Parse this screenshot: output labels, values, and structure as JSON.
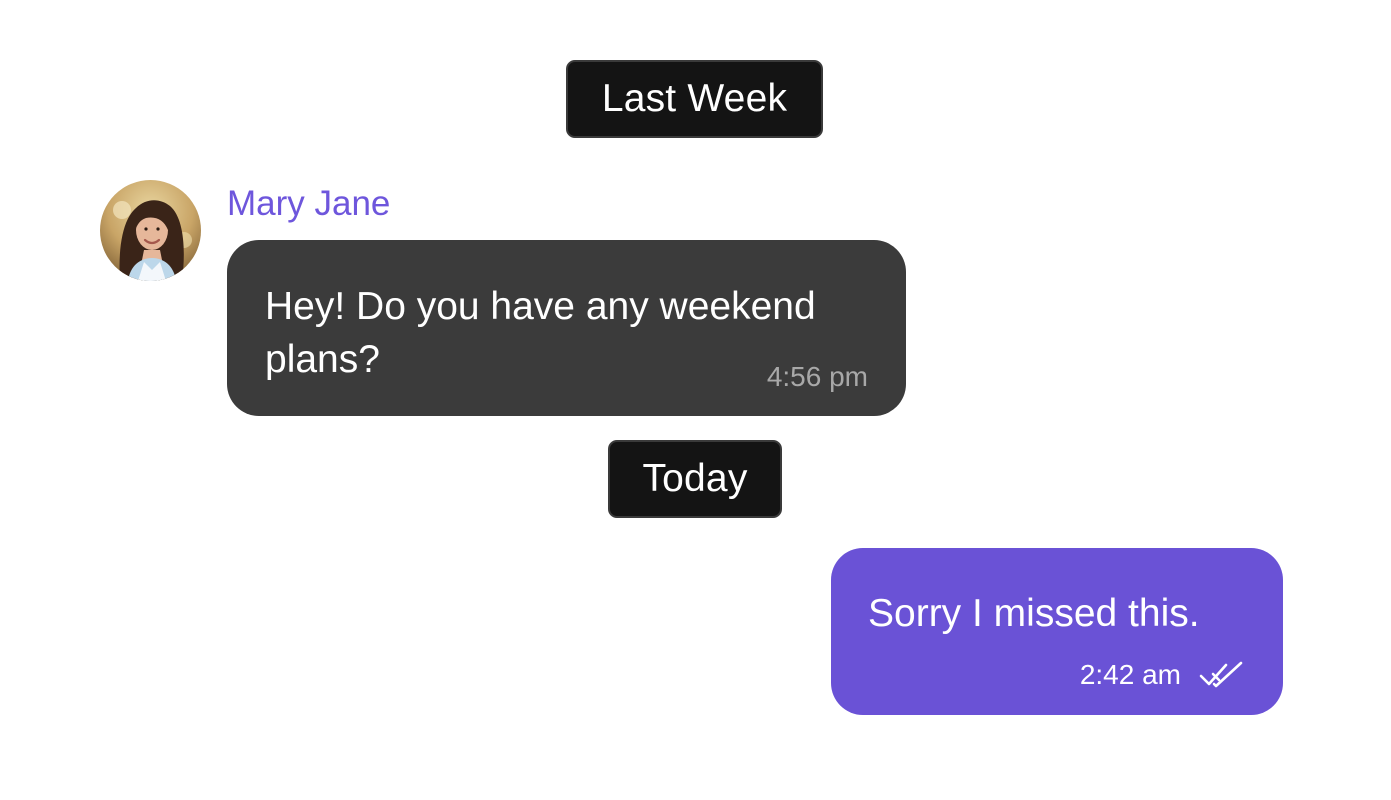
{
  "colors": {
    "accent": "#6a52d6",
    "sender_name": "#6e56dc",
    "incoming_bubble": "#3b3b3b",
    "date_pill": "#141414"
  },
  "separators": {
    "last_week": "Last Week",
    "today": "Today"
  },
  "messages": [
    {
      "direction": "incoming",
      "sender": "Mary Jane",
      "avatar_icon": "user-avatar-photo",
      "text": "Hey! Do you have any weekend plans?",
      "time": "4:56 pm"
    },
    {
      "direction": "outgoing",
      "text": "Sorry I missed this.",
      "time": "2:42 am",
      "status_icon": "double-check-read-icon"
    }
  ]
}
